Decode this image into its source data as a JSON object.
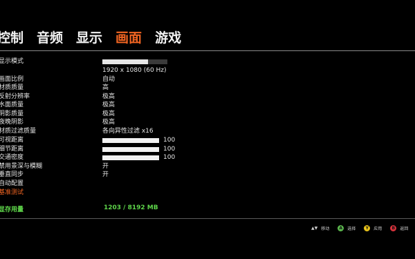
{
  "tabs": [
    {
      "label": "控制",
      "active": false
    },
    {
      "label": "音频",
      "active": false
    },
    {
      "label": "显示",
      "active": false
    },
    {
      "label": "画面",
      "active": true
    },
    {
      "label": "游戏",
      "active": false
    }
  ],
  "settings": {
    "display_mode": {
      "label": "显示模式",
      "level": 0.7
    },
    "resolution": {
      "value": "1920 x 1080 (60 Hz)"
    },
    "aspect_ratio": {
      "label": "画面比例",
      "value": "自动"
    },
    "texture_quality": {
      "label": "材质质量",
      "value": "高"
    },
    "reflection_resolution": {
      "label": "反射分辨率",
      "value": "极高"
    },
    "water_quality": {
      "label": "水面质量",
      "value": "极高"
    },
    "shadow_quality": {
      "label": "阴影质量",
      "value": "极高"
    },
    "night_shadows": {
      "label": "夜晚阴影",
      "value": "极高"
    },
    "texture_filtering": {
      "label": "材质过滤质量",
      "value": "各向异性过滤 x16"
    },
    "view_distance": {
      "label": "可视距离",
      "value": "100"
    },
    "detail_distance": {
      "label": "细节距离",
      "value": "100"
    },
    "traffic_density": {
      "label": "交通密度",
      "value": "100"
    },
    "disable_dof_blur": {
      "label": "禁用景深与模糊",
      "value": "开"
    },
    "vsync": {
      "label": "垂直同步",
      "value": "开"
    },
    "auto_config": {
      "label": "自动配置"
    },
    "benchmark": {
      "label": "基准测试"
    }
  },
  "vram": {
    "label": "显存用量",
    "value": "1203 / 8192 MB"
  },
  "hints": {
    "move": "移动",
    "select": "选择",
    "apply": "应用",
    "back": "返回",
    "select_key": "A",
    "apply_key": "Y",
    "back_key": "B"
  },
  "colors": {
    "accent": "#f26522",
    "vram_green": "#5ed64a",
    "btn_a": "#5bb84d",
    "btn_y": "#e8c21a",
    "btn_b": "#d8323b"
  }
}
